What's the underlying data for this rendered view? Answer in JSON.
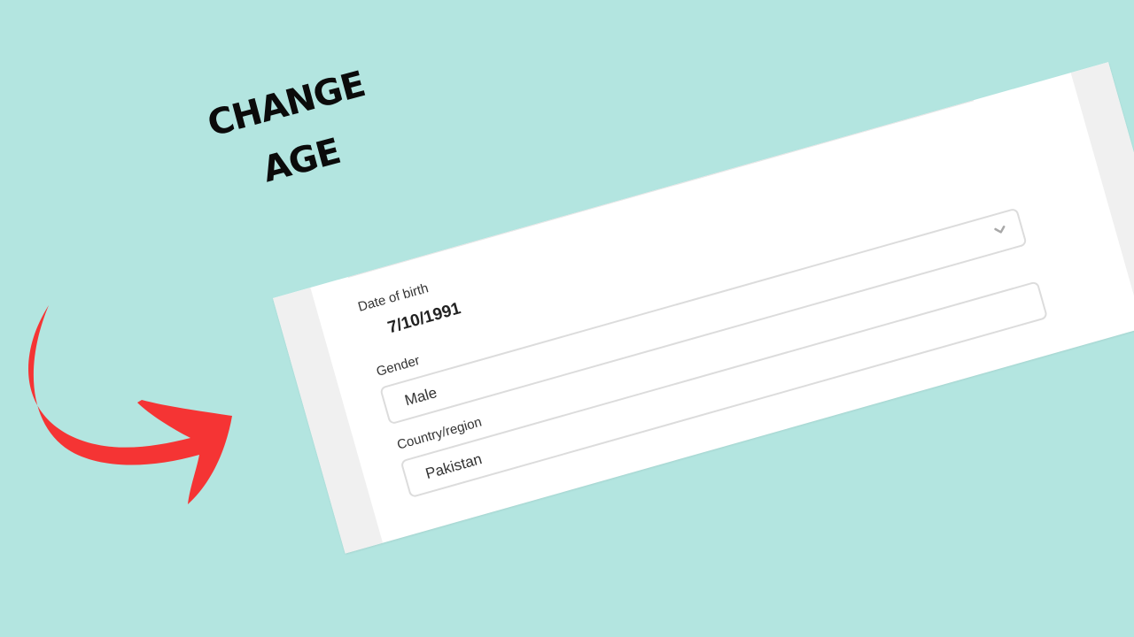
{
  "headline": {
    "line1": "CHANGE",
    "line2": "AGE"
  },
  "colors": {
    "background": "#b3e5e0",
    "arrow": "#f53434",
    "card": "#ffffff",
    "card_side": "#f0f0f0",
    "field_border": "#dcdcdc"
  },
  "form": {
    "date_of_birth": {
      "label": "Date of birth",
      "value": "7/10/1991"
    },
    "gender": {
      "label": "Gender",
      "value": "Male",
      "icon": "chevron-down-icon"
    },
    "country": {
      "label": "Country/region",
      "value": "Pakistan"
    },
    "top_select": {
      "icon": "chevron-down-icon"
    }
  }
}
